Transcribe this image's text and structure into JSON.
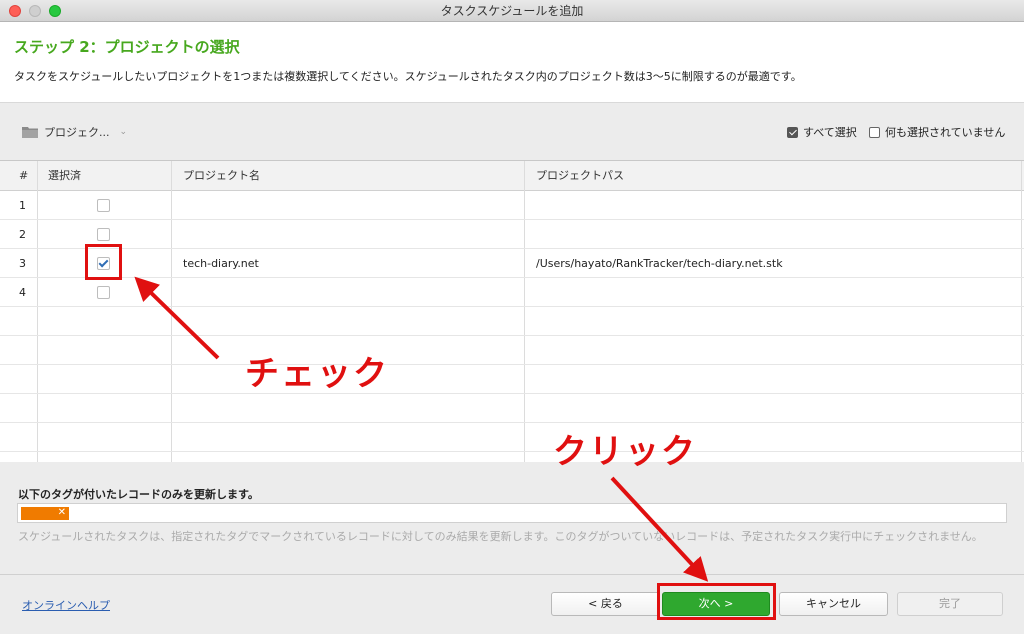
{
  "window": {
    "title": "タスクスケジュールを追加"
  },
  "header": {
    "step_title": "ステップ 2：プロジェクトの選択",
    "description": "タスクをスケジュールしたいプロジェクトを1つまたは複数選択してください。スケジュールされたタスク内のプロジェクト数は3〜5に制限するのが最適です。"
  },
  "toolbar": {
    "project_button": "プロジェク...",
    "select_all": "すべて選択",
    "select_none": "何も選択されていません"
  },
  "table": {
    "columns": [
      "#",
      "選択済",
      "プロジェクト名",
      "プロジェクトパス"
    ],
    "rows": [
      {
        "num": "1",
        "checked": false,
        "name": "",
        "path": ""
      },
      {
        "num": "2",
        "checked": false,
        "name": "",
        "path": ""
      },
      {
        "num": "3",
        "checked": true,
        "name": "tech-diary.net",
        "path": "/Users/hayato/RankTracker/tech-diary.net.stk"
      },
      {
        "num": "4",
        "checked": false,
        "name": "",
        "path": ""
      }
    ]
  },
  "tags": {
    "title": "以下のタグが付いたレコードのみを更新します。",
    "chip_color": "#f07b00",
    "note": "スケジュールされたタスクは、指定されたタグでマークされているレコードに対してのみ結果を更新します。このタグがついていないレコードは、予定されたタスク実行中にチェックされません。"
  },
  "footer": {
    "help": "オンラインヘルプ",
    "back": "< 戻る",
    "next": "次へ >",
    "cancel": "キャンセル",
    "finish": "完了"
  },
  "annotations": {
    "check_label": "チェック",
    "click_label": "クリック",
    "color": "#e01010"
  }
}
